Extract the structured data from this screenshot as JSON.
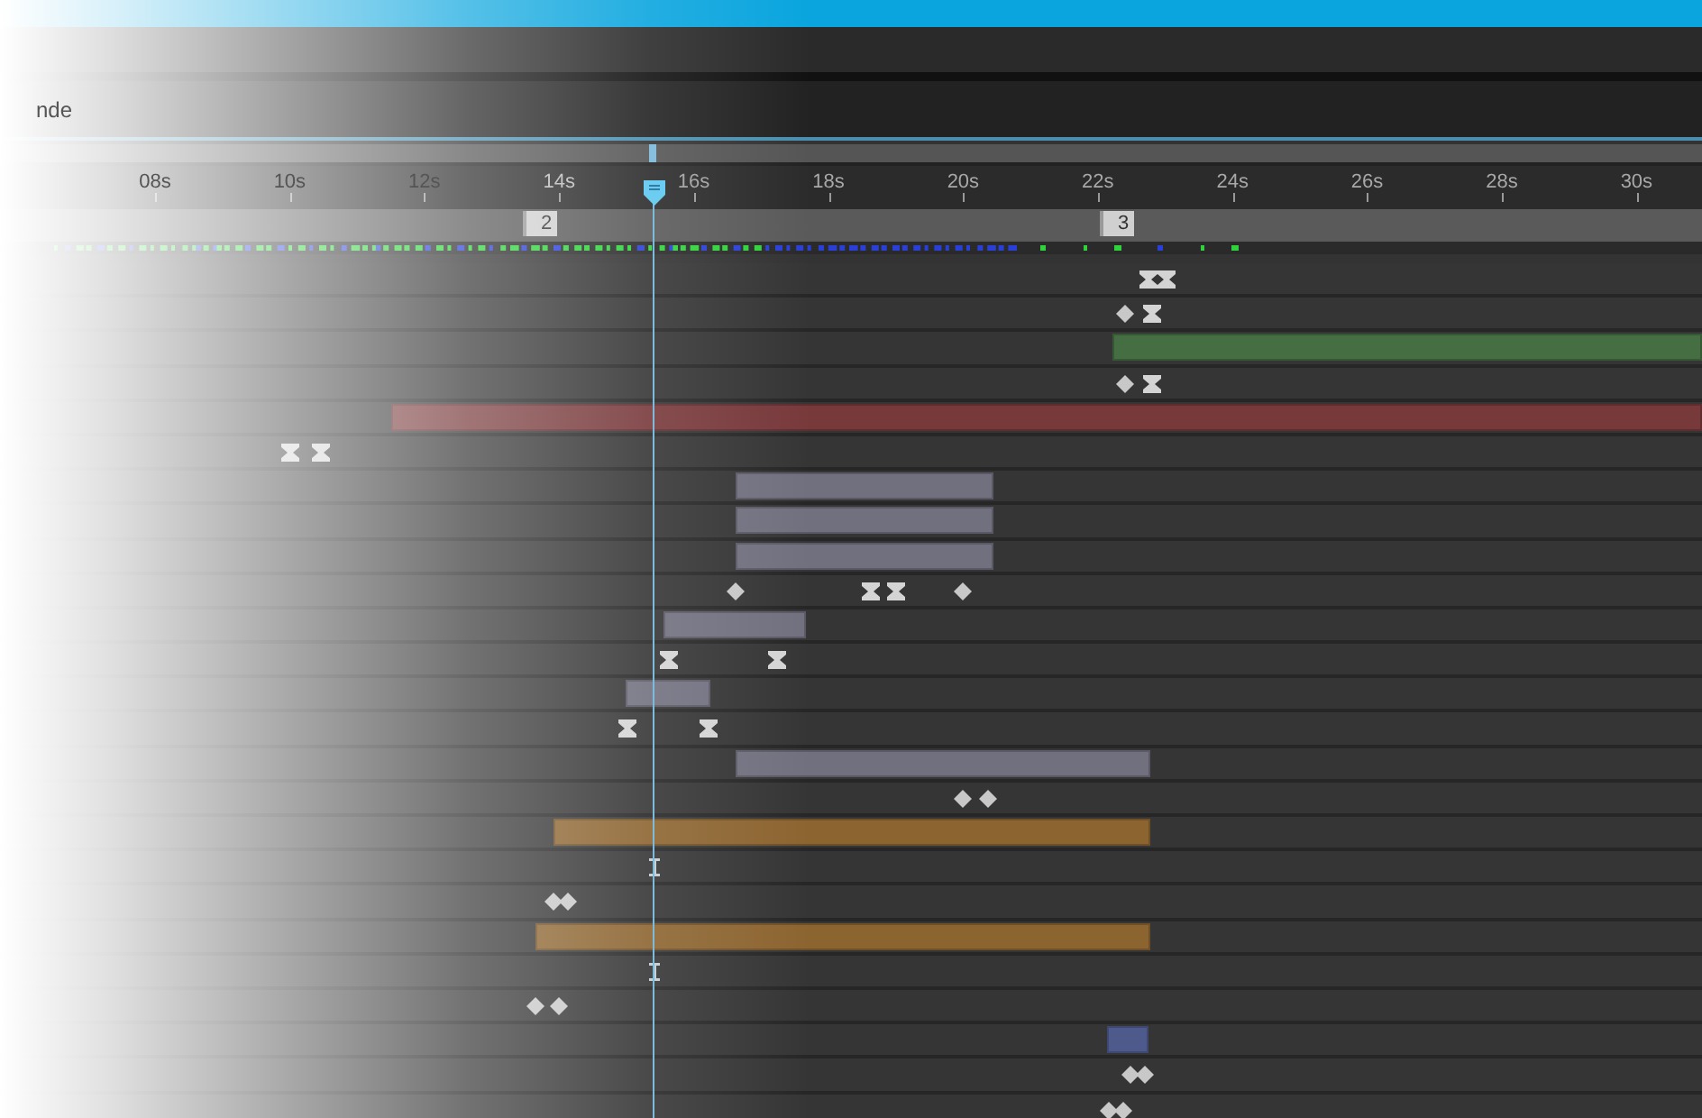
{
  "panel": {
    "title": "nde"
  },
  "ruler": {
    "labels": [
      "08s",
      "10s",
      "12s",
      "14s",
      "16s",
      "18s",
      "20s",
      "22s",
      "24s",
      "26s",
      "28s",
      "30s"
    ]
  },
  "markers": [
    {
      "label": "2"
    },
    {
      "label": "3"
    }
  ],
  "rows": [
    {
      "kind": "keys",
      "keys": [
        {
          "kind": "hourglass"
        },
        {
          "kind": "hourglass"
        }
      ]
    },
    {
      "kind": "keys",
      "keys": [
        {
          "kind": "diamond"
        },
        {
          "kind": "hourglass"
        }
      ]
    },
    {
      "kind": "bar",
      "color": "#456f43"
    },
    {
      "kind": "keys",
      "keys": [
        {
          "kind": "diamond"
        },
        {
          "kind": "hourglass"
        }
      ]
    },
    {
      "kind": "bar",
      "color": "#78393b"
    },
    {
      "kind": "keys",
      "keys": [
        {
          "kind": "hourglass"
        },
        {
          "kind": "hourglass"
        }
      ]
    },
    {
      "kind": "bar",
      "color": "#71707f"
    },
    {
      "kind": "bar",
      "color": "#71707f"
    },
    {
      "kind": "bar",
      "color": "#71707f"
    },
    {
      "kind": "keys",
      "keys": [
        {
          "kind": "diamond"
        },
        {
          "kind": "hourglass"
        },
        {
          "kind": "hourglass"
        },
        {
          "kind": "diamond"
        }
      ]
    },
    {
      "kind": "bar",
      "color": "#71707f"
    },
    {
      "kind": "keys",
      "keys": [
        {
          "kind": "hourglass"
        },
        {
          "kind": "hourglass"
        }
      ]
    },
    {
      "kind": "bar",
      "color": "#71707f"
    },
    {
      "kind": "keys",
      "keys": [
        {
          "kind": "hourglass"
        },
        {
          "kind": "hourglass"
        }
      ]
    },
    {
      "kind": "bar",
      "color": "#71707f"
    },
    {
      "kind": "keys",
      "keys": [
        {
          "kind": "diamond"
        },
        {
          "kind": "diamond"
        }
      ]
    },
    {
      "kind": "bar",
      "color": "#8c6430"
    },
    {
      "kind": "keys",
      "keys": [
        {
          "kind": "ibeam"
        }
      ]
    },
    {
      "kind": "keys",
      "keys": [
        {
          "kind": "diamond"
        },
        {
          "kind": "diamond"
        }
      ]
    },
    {
      "kind": "bar",
      "color": "#8c6430"
    },
    {
      "kind": "keys",
      "keys": [
        {
          "kind": "ibeam"
        }
      ]
    },
    {
      "kind": "keys",
      "keys": [
        {
          "kind": "diamond"
        },
        {
          "kind": "diamond"
        }
      ]
    },
    {
      "kind": "bar",
      "color": "#4e5a8c"
    },
    {
      "kind": "keys",
      "keys": [
        {
          "kind": "diamond"
        },
        {
          "kind": "diamond"
        }
      ]
    },
    {
      "kind": "keys",
      "keys": [
        {
          "kind": "diamond"
        },
        {
          "kind": "diamond"
        }
      ]
    }
  ]
}
